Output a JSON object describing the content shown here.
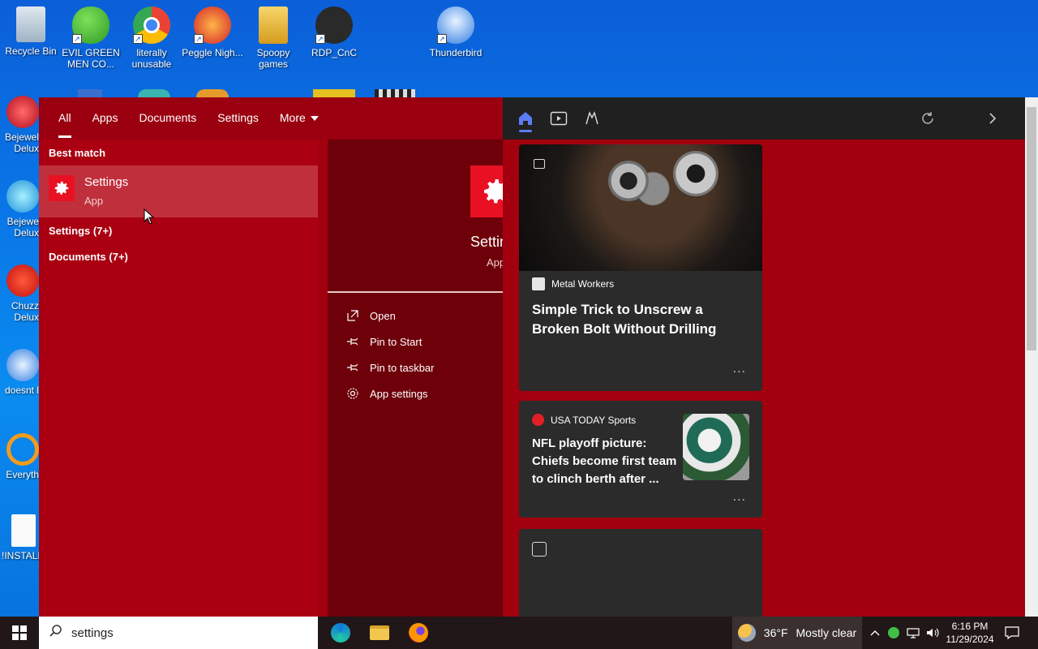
{
  "desktop": {
    "icons": [
      {
        "label": "Recycle Bin"
      },
      {
        "label": "EVIL GREEN MEN CO..."
      },
      {
        "label": "literally unusable"
      },
      {
        "label": "Peggle Nigh..."
      },
      {
        "label": "Spoopy games"
      },
      {
        "label": "RDP_CnC"
      },
      {
        "label": "Thunderbird"
      }
    ],
    "left_icons": [
      {
        "label": "Bejewel Delux"
      },
      {
        "label": "Bejewe Delux"
      },
      {
        "label": "Chuzz Delux"
      },
      {
        "label": "doesnt l"
      },
      {
        "label": "Everyth"
      },
      {
        "label": "!INSTALL"
      }
    ]
  },
  "search": {
    "tabs": [
      "All",
      "Apps",
      "Documents",
      "Settings",
      "More"
    ],
    "active_tab": "All",
    "best_match_header": "Best match",
    "best_match": {
      "name": "Settings",
      "kind": "App"
    },
    "groups": [
      "Settings (7+)",
      "Documents (7+)"
    ],
    "detail": {
      "name": "Settings",
      "kind": "App",
      "actions": [
        "Open",
        "Pin to Start",
        "Pin to taskbar",
        "App settings"
      ]
    },
    "query": "settings"
  },
  "news": {
    "cards": [
      {
        "source": "Metal Workers",
        "headline": "Simple Trick to Unscrew a Broken Bolt Without Drilling",
        "more": "..."
      },
      {
        "source": "USA TODAY Sports",
        "headline": "NFL playoff picture: Chiefs become first team to clinch berth after ...",
        "more": "..."
      }
    ]
  },
  "taskbar": {
    "weather_temp": "36°F",
    "weather_desc": "Mostly clear",
    "time": "6:16 PM",
    "date": "11/29/2024"
  },
  "colors": {
    "accent": "#e81123",
    "panel": "#a3000f",
    "taskbar": "#211718"
  }
}
